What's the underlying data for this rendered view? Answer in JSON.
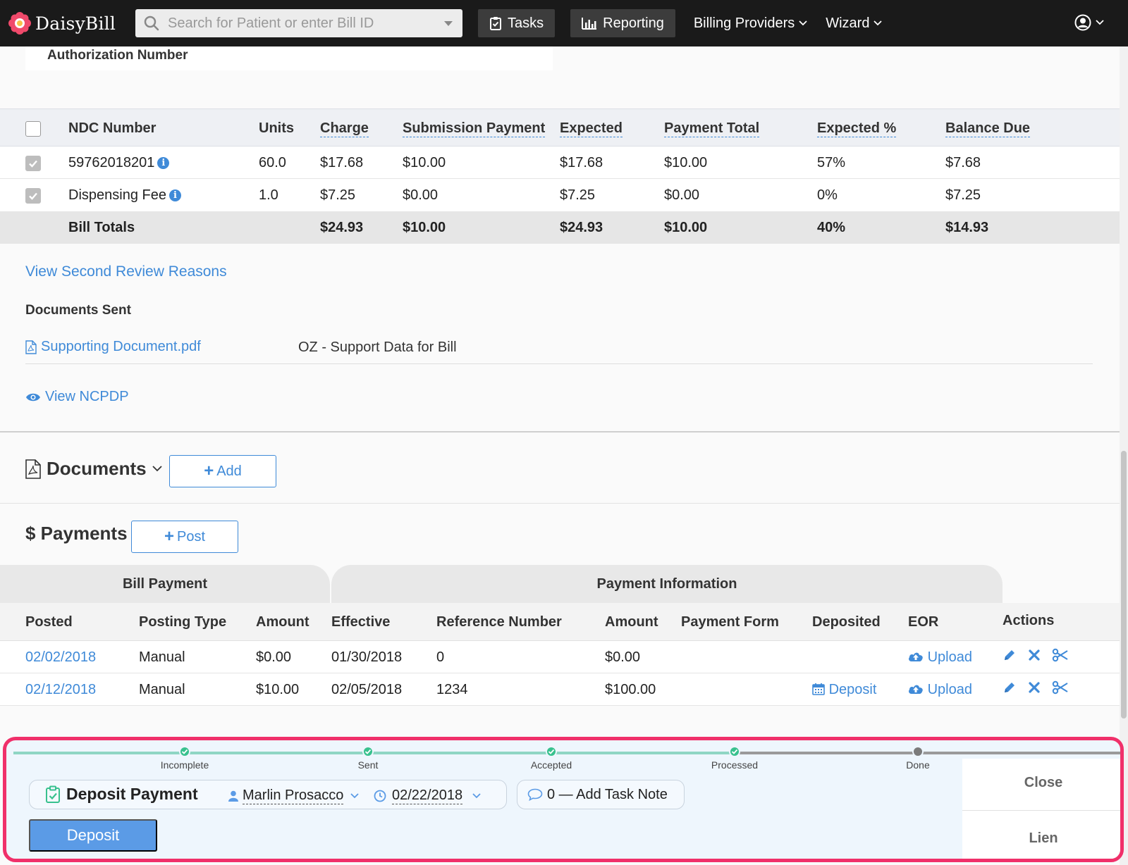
{
  "navbar": {
    "brand": "DaisyBill",
    "search_placeholder": "Search for Patient or enter Bill ID",
    "tasks_label": "Tasks",
    "reporting_label": "Reporting",
    "billing_providers_label": "Billing Providers",
    "wizard_label": "Wizard"
  },
  "authorization": {
    "label": "Authorization Number"
  },
  "ndc_table": {
    "headers": [
      "NDC Number",
      "Units",
      "Charge",
      "Submission Payment",
      "Expected",
      "Payment Total",
      "Expected %",
      "Balance Due"
    ],
    "rows": [
      {
        "ndc": "59762018201",
        "units": "60.0",
        "charge": "$17.68",
        "submission_payment": "$10.00",
        "expected": "$17.68",
        "payment_total": "$10.00",
        "expected_pct": "57%",
        "balance_due": "$7.68"
      },
      {
        "ndc": "Dispensing Fee",
        "units": "1.0",
        "charge": "$7.25",
        "submission_payment": "$0.00",
        "expected": "$7.25",
        "payment_total": "$0.00",
        "expected_pct": "0%",
        "balance_due": "$7.25"
      }
    ],
    "totals": {
      "label": "Bill Totals",
      "charge": "$24.93",
      "submission_payment": "$10.00",
      "expected": "$24.93",
      "payment_total": "$10.00",
      "expected_pct": "40%",
      "balance_due": "$14.93"
    }
  },
  "review": {
    "view_second_review": "View Second Review Reasons"
  },
  "documents_sent": {
    "title": "Documents Sent",
    "file_name": "Supporting Document.pdf",
    "file_type": "OZ - Support Data for Bill",
    "view_ncpdp": "View NCPDP"
  },
  "documents": {
    "title": "Documents",
    "add_label": "Add"
  },
  "payments": {
    "title": "$ Payments",
    "post_label": "Post",
    "group_bill_payment": "Bill Payment",
    "group_payment_information": "Payment Information",
    "headers": [
      "Posted",
      "Posting Type",
      "Amount",
      "Effective",
      "Reference Number",
      "Amount",
      "Payment Form",
      "Deposited",
      "EOR",
      "Actions"
    ],
    "rows": [
      {
        "posted": "02/02/2018",
        "posting_type": "Manual",
        "amount": "$0.00",
        "effective": "01/30/2018",
        "reference": "0",
        "pay_amount": "$0.00",
        "payment_form": "",
        "deposited": "",
        "eor": "Upload"
      },
      {
        "posted": "02/12/2018",
        "posting_type": "Manual",
        "amount": "$10.00",
        "effective": "02/05/2018",
        "reference": "1234",
        "pay_amount": "$100.00",
        "payment_form": "",
        "deposited": "Deposit",
        "eor": "Upload"
      }
    ]
  },
  "task": {
    "steps": [
      "Incomplete",
      "Sent",
      "Accepted",
      "Processed",
      "Done"
    ],
    "completed_steps": 4,
    "name": "Deposit Payment",
    "assignee": "Marlin Prosacco",
    "due_date": "02/22/2018",
    "note_label": "0 — Add Task Note",
    "deposit_label": "Deposit",
    "close_label": "Close",
    "lien_label": "Lien"
  },
  "colors": {
    "accent": "#3f8ad8",
    "highlight": "#f0306a",
    "progress": "#38c18e"
  }
}
